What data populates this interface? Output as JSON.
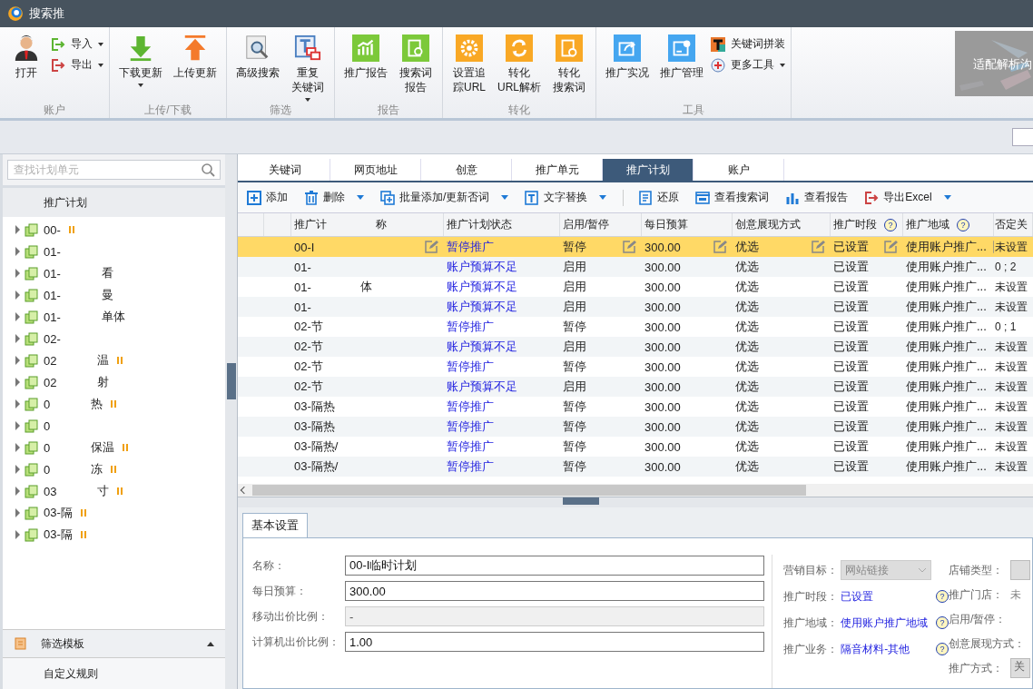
{
  "window": {
    "title": "搜索推"
  },
  "ribbon": {
    "groups": [
      {
        "label": "账户",
        "items": [
          {
            "lines": [
              "打开"
            ],
            "dropdown": false
          }
        ],
        "small_items": [
          {
            "label": "导入",
            "dropdown": true
          },
          {
            "label": "导出",
            "dropdown": true
          }
        ]
      },
      {
        "label": "上传/下载",
        "items": [
          {
            "lines": [
              "下载更新"
            ],
            "dropdown": true
          },
          {
            "lines": [
              "上传更新"
            ],
            "dropdown": false
          }
        ]
      },
      {
        "label": "筛选",
        "items": [
          {
            "lines": [
              "高级搜索"
            ],
            "dropdown": false
          },
          {
            "lines": [
              "重复",
              "关键词"
            ],
            "dropdown": true
          }
        ]
      },
      {
        "label": "报告",
        "items": [
          {
            "lines": [
              "推广报告"
            ],
            "dropdown": false
          },
          {
            "lines": [
              "搜索词",
              "报告"
            ],
            "dropdown": false
          }
        ]
      },
      {
        "label": "转化",
        "items": [
          {
            "lines": [
              "设置追",
              "踪URL"
            ],
            "dropdown": false
          },
          {
            "lines": [
              "转化",
              "URL解析"
            ],
            "dropdown": false
          },
          {
            "lines": [
              "转化",
              "搜索词"
            ],
            "dropdown": false
          }
        ]
      },
      {
        "label": "工具",
        "items": [
          {
            "lines": [
              "推广实况"
            ],
            "dropdown": false
          },
          {
            "lines": [
              "推广管理"
            ],
            "dropdown": false
          }
        ],
        "small_items": [
          {
            "label": "关键词拼装",
            "dropdown": false
          },
          {
            "label": "更多工具",
            "dropdown": true
          }
        ]
      }
    ],
    "banner": {
      "text": "适配解析沟"
    }
  },
  "sidebar": {
    "search": {
      "placeholder": "查找计划单元"
    },
    "header": "推广计划",
    "items": [
      {
        "label": "00-",
        "paused": true
      },
      {
        "label": "01-",
        "paused": false
      },
      {
        "label": "01-",
        "suffix": "看",
        "paused": false
      },
      {
        "label": "01-",
        "suffix": "曼",
        "paused": false
      },
      {
        "label": "01-",
        "suffix": "单体",
        "paused": false
      },
      {
        "label": "02-",
        "paused": false
      },
      {
        "label": "02",
        "suffix": "温",
        "paused": true
      },
      {
        "label": "02",
        "suffix": "射",
        "paused": false
      },
      {
        "label": "0",
        "suffix": "热",
        "paused": true
      },
      {
        "label": "0",
        "paused": false
      },
      {
        "label": "0",
        "suffix": "保温",
        "paused": true
      },
      {
        "label": "0",
        "suffix": "冻",
        "paused": true
      },
      {
        "label": "03",
        "suffix": "寸",
        "paused": true
      },
      {
        "label": "03-隔",
        "paused": true
      },
      {
        "label": "03-隔",
        "paused": true
      }
    ],
    "bottom": [
      {
        "label": "筛选模板",
        "kind": "header"
      },
      {
        "label": "自定义规则",
        "kind": "item"
      }
    ]
  },
  "tabs": [
    {
      "label": "关键词",
      "selected": false
    },
    {
      "label": "网页地址",
      "selected": false
    },
    {
      "label": "创意",
      "selected": false
    },
    {
      "label": "推广单元",
      "selected": false
    },
    {
      "label": "推广计划",
      "selected": true
    },
    {
      "label": "账户",
      "selected": false
    }
  ],
  "toolbar": [
    {
      "label": "添加",
      "dropdown": false,
      "separator": false
    },
    {
      "label": "删除",
      "dropdown": true,
      "separator": false
    },
    {
      "label": "批量添加/更新否词",
      "dropdown": true,
      "separator": false
    },
    {
      "label": "文字替换",
      "dropdown": true,
      "separator": true
    },
    {
      "label": "还原",
      "dropdown": false,
      "separator": false
    },
    {
      "label": "查看搜索词",
      "dropdown": false,
      "separator": false
    },
    {
      "label": "查看报告",
      "dropdown": false,
      "separator": false
    },
    {
      "label": "导出Excel",
      "dropdown": true,
      "separator": false
    }
  ],
  "table": {
    "columns": [
      {
        "label": "推广计",
        "suffix": "称",
        "kind": "editable"
      },
      {
        "label": "推广计划状态",
        "kind": "status"
      },
      {
        "label": "启用/暂停",
        "kind": "editable"
      },
      {
        "label": "每日预算",
        "kind": "editable"
      },
      {
        "label": "创意展现方式",
        "kind": "editable"
      },
      {
        "label": "推广时段",
        "help": "?",
        "kind": "editable"
      },
      {
        "label": "推广地域",
        "help": "?",
        "kind": "editable"
      },
      {
        "label": "否定关",
        "kind": "plain"
      }
    ],
    "rows": [
      {
        "selected": true,
        "cells": [
          "00-I",
          "暂停推广",
          "暂停",
          "300.00",
          "优选",
          "已设置",
          "使用账户推广...",
          "未设置"
        ]
      },
      {
        "selected": false,
        "cells": [
          "01-",
          "账户预算不足",
          "启用",
          "300.00",
          "优选",
          "已设置",
          "使用账户推广...",
          "0 ; 2"
        ]
      },
      {
        "selected": false,
        "cells": [
          "01-",
          "账户预算不足",
          "启用",
          "300.00",
          "优选",
          "已设置",
          "使用账户推广...",
          "未设置"
        ],
        "suffix": "体"
      },
      {
        "selected": false,
        "cells": [
          "01-",
          "账户预算不足",
          "启用",
          "300.00",
          "优选",
          "已设置",
          "使用账户推广...",
          "未设置"
        ]
      },
      {
        "selected": false,
        "cells": [
          "02-节",
          "暂停推广",
          "暂停",
          "300.00",
          "优选",
          "已设置",
          "使用账户推广...",
          "0 ; 1"
        ]
      },
      {
        "selected": false,
        "cells": [
          "02-节",
          "账户预算不足",
          "启用",
          "300.00",
          "优选",
          "已设置",
          "使用账户推广...",
          "未设置"
        ]
      },
      {
        "selected": false,
        "cells": [
          "02-节",
          "暂停推广",
          "暂停",
          "300.00",
          "优选",
          "已设置",
          "使用账户推广...",
          "未设置"
        ]
      },
      {
        "selected": false,
        "cells": [
          "02-节",
          "账户预算不足",
          "启用",
          "300.00",
          "优选",
          "已设置",
          "使用账户推广...",
          "未设置"
        ]
      },
      {
        "selected": false,
        "cells": [
          "03-隔热",
          "暂停推广",
          "暂停",
          "300.00",
          "优选",
          "已设置",
          "使用账户推广...",
          "未设置"
        ]
      },
      {
        "selected": false,
        "cells": [
          "03-隔热",
          "暂停推广",
          "暂停",
          "300.00",
          "优选",
          "已设置",
          "使用账户推广...",
          "未设置"
        ]
      },
      {
        "selected": false,
        "cells": [
          "03-隔热/",
          "暂停推广",
          "暂停",
          "300.00",
          "优选",
          "已设置",
          "使用账户推广...",
          "未设置"
        ]
      },
      {
        "selected": false,
        "cells": [
          "03-隔热/",
          "暂停推广",
          "暂停",
          "300.00",
          "优选",
          "已设置",
          "使用账户推广...",
          "未设置"
        ]
      }
    ]
  },
  "detail": {
    "tab": "基本设置",
    "fields": [
      {
        "label": "名称：",
        "value": "00-I临时计划",
        "disabled": false
      },
      {
        "label": "每日预算：",
        "value": "300.00",
        "disabled": false
      },
      {
        "label": "移动出价比例：",
        "value": "-",
        "disabled": true
      },
      {
        "label": "计算机出价比例：",
        "value": "1.00",
        "disabled": false
      }
    ],
    "settings": [
      {
        "label": "营销目标：",
        "kind": "select",
        "value": "网站链接"
      },
      {
        "label": "推广时段：",
        "kind": "link",
        "value": "已设置",
        "help": "?"
      },
      {
        "label": "推广地域：",
        "kind": "link",
        "value": "使用账户推广地域",
        "help": "?"
      },
      {
        "label": "推广业务：",
        "kind": "link",
        "value": "隔音材料-其他",
        "help": "?"
      }
    ],
    "extra": [
      {
        "label": "店铺类型：",
        "kind": "box"
      },
      {
        "label": "推广门店：",
        "kind": "text",
        "value": "未"
      },
      {
        "label": "启用/暂停：",
        "kind": "none"
      },
      {
        "label": "创意展现方式：",
        "kind": "none"
      },
      {
        "label": "推广方式：",
        "kind": "box",
        "value": "关"
      }
    ]
  }
}
